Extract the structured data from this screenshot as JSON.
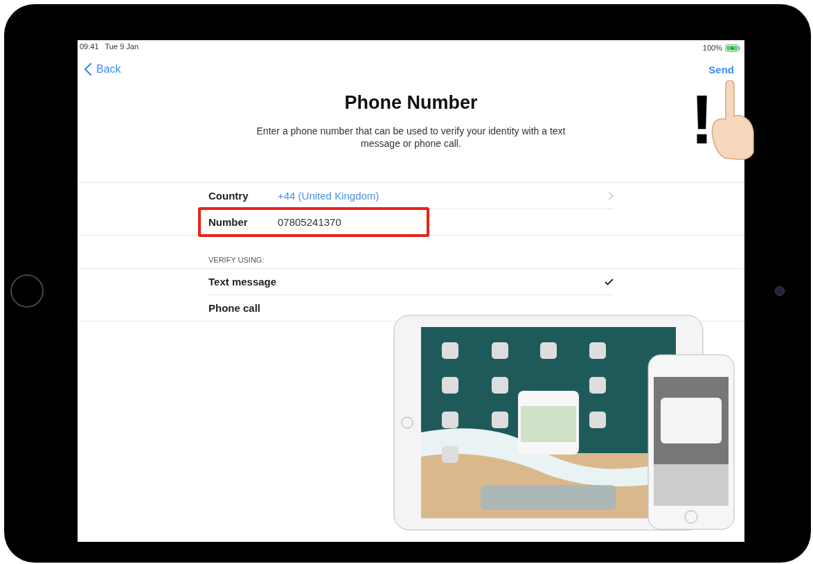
{
  "status_bar": {
    "time": "09:41",
    "date": "Tue 9 Jan",
    "battery": "100%"
  },
  "nav": {
    "back": "Back",
    "action": "Send"
  },
  "title": "Phone Number",
  "description": "Enter a phone number that can be used to verify your identity with a text message or phone call.",
  "fields": [
    {
      "label": "Country",
      "value": "+44 (United Kingdom)",
      "kind": "picker",
      "highlighted": false
    },
    {
      "label": "Number",
      "value": "07805241370",
      "kind": "text",
      "highlighted": true
    }
  ],
  "verify": {
    "header": "VERIFY USING:",
    "options": [
      {
        "label": "Text message",
        "selected": true
      },
      {
        "label": "Phone call",
        "selected": false
      }
    ]
  },
  "annotation": {
    "mark": "!"
  }
}
